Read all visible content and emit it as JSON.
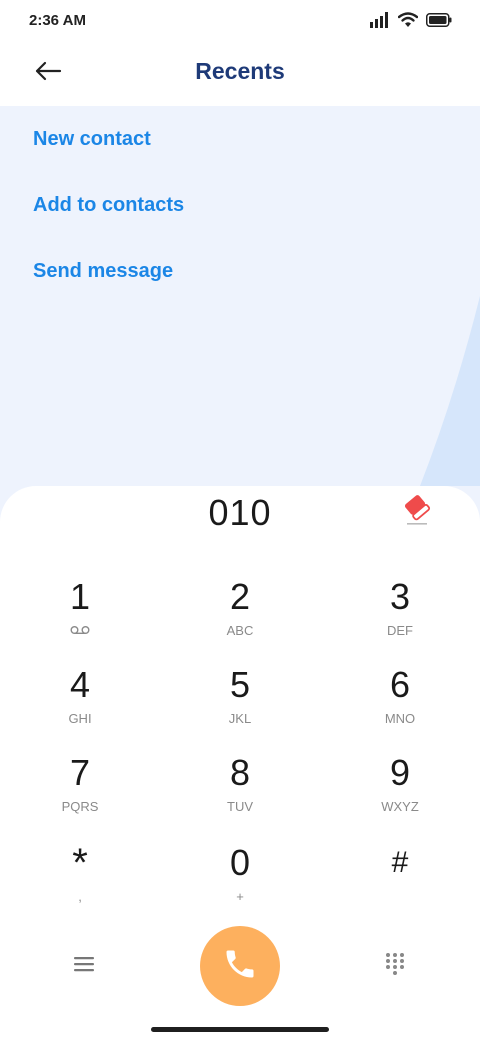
{
  "status_bar": {
    "time": "2:36 AM",
    "icons": [
      "signal-icon",
      "wifi-icon",
      "battery-icon"
    ]
  },
  "header": {
    "title": "Recents",
    "back_icon": "arrow-left-icon"
  },
  "actions": [
    {
      "label": "New contact"
    },
    {
      "label": "Add to contacts"
    },
    {
      "label": "Send message"
    }
  ],
  "dialer": {
    "number": "010",
    "clear_icon": "eraser-icon",
    "keys": [
      {
        "digit": "1",
        "letters": ""
      },
      {
        "digit": "2",
        "letters": "ABC"
      },
      {
        "digit": "3",
        "letters": "DEF"
      },
      {
        "digit": "4",
        "letters": "GHI"
      },
      {
        "digit": "5",
        "letters": "JKL"
      },
      {
        "digit": "6",
        "letters": "MNO"
      },
      {
        "digit": "7",
        "letters": "PQRS"
      },
      {
        "digit": "8",
        "letters": "TUV"
      },
      {
        "digit": "9",
        "letters": "WXYZ"
      },
      {
        "digit": "*",
        "letters": ","
      },
      {
        "digit": "0",
        "letters": "+"
      },
      {
        "digit": "#",
        "letters": ""
      }
    ]
  },
  "bottom_bar": {
    "menu_icon": "menu-icon",
    "call_icon": "phone-icon",
    "keypad_icon": "dialpad-icon"
  },
  "colors": {
    "title": "#1e3a78",
    "link": "#1b86e6",
    "call_button": "#fdb05e",
    "clear_icon": "#ef4b4b",
    "panel_background": "#eef3fd",
    "arc": "#d6e6fb"
  }
}
